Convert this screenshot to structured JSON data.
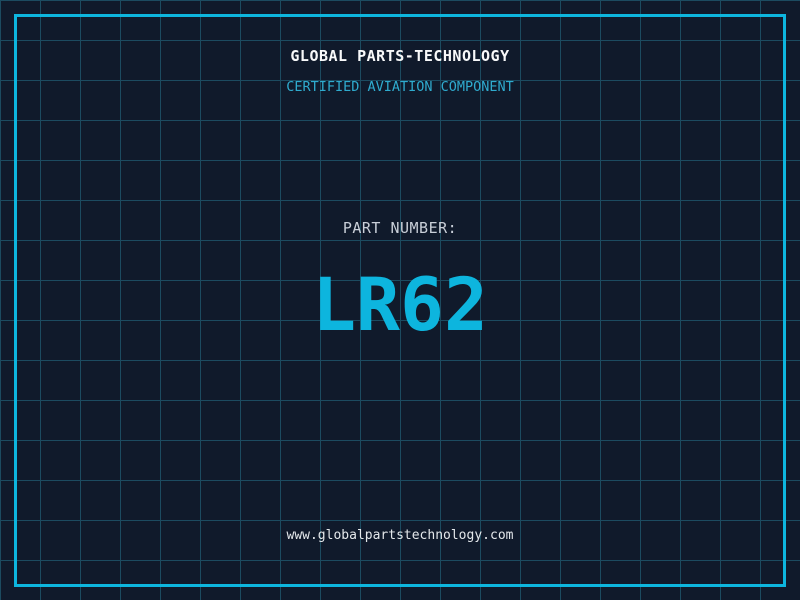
{
  "header": {
    "company_name": "GLOBAL PARTS-TECHNOLOGY",
    "tagline": "CERTIFIED AVIATION COMPONENT"
  },
  "part": {
    "label": "PART NUMBER:",
    "number": "LR62"
  },
  "footer": {
    "website": "www.globalpartstechnology.com"
  },
  "colors": {
    "background": "#101a2b",
    "grid_line": "#1c4b60",
    "frame": "#0db5de",
    "title_text": "#f8f9fa",
    "tagline_text": "#2fabce",
    "label_text": "#c9cfd8",
    "part_number_text": "#0db5de",
    "footer_text": "#e4e8eb"
  }
}
